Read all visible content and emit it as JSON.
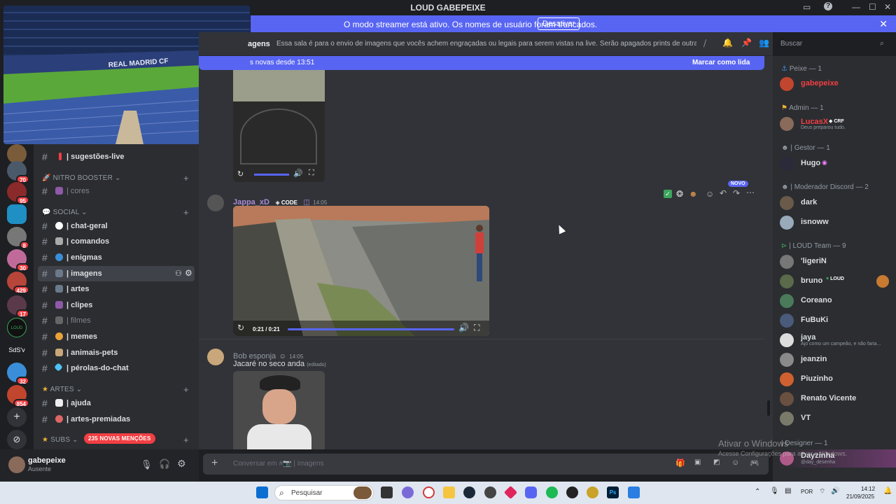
{
  "window": {
    "title": "LOUD GABEPEIXE",
    "icons": [
      "screen-share-icon",
      "help-icon",
      "minimize-icon",
      "maximize-icon",
      "close-icon"
    ]
  },
  "banner": {
    "message": "O modo streamer está ativo. Os nomes de usuário foram truncados.",
    "button": "Desativar"
  },
  "rail": {
    "items": [
      {
        "badge": "70"
      },
      {
        "badge": "95"
      },
      {
        "badge": "8"
      },
      {
        "badge": "30"
      },
      {
        "badge": "429"
      },
      {
        "badge": "17"
      },
      {
        "label": "LOUD"
      },
      {
        "label": "SdS'v"
      },
      {
        "badge": "32"
      },
      {
        "badge": "854"
      }
    ]
  },
  "video": {
    "stadium_text": "REAL MADRID CF"
  },
  "channels": {
    "items": [
      {
        "label": "| sugestões-live",
        "top": 0
      },
      {
        "category": "NITRO BOOSTER"
      },
      {
        "label": "| cores",
        "dim": true
      },
      {
        "category": "SOCIAL"
      },
      {
        "label": "| chat-geral"
      },
      {
        "label": "| comandos"
      },
      {
        "label": "| enigmas"
      },
      {
        "label": "| imagens",
        "active": true
      },
      {
        "label": "| artes"
      },
      {
        "label": "| clipes"
      },
      {
        "label": "| filmes",
        "dim": true
      },
      {
        "label": "| memes"
      },
      {
        "label": "| animais-pets"
      },
      {
        "label": "| pérolas-do-chat"
      },
      {
        "category": "ARTES"
      },
      {
        "label": "| ajuda"
      },
      {
        "label": "| artes-premiadas"
      },
      {
        "category": "SUBS",
        "mentions": "235 NOVAS MENÇÕES"
      }
    ]
  },
  "user": {
    "name": "gabepeixe",
    "status": "Ausente"
  },
  "header": {
    "channel": "agens",
    "topic": "Essa sala é para o envio de imagens que vocês achem engraçadas ou legais para serem vistas na live. Serão apagados prints de outras redes sociais c...",
    "search_placeholder": "Buscar"
  },
  "newbar": {
    "text": "s novas desde 13:51",
    "action": "Marcar como lida"
  },
  "messages": [
    {
      "author": "Jappa_xD",
      "tag": "CODE",
      "time": "14:05",
      "video_time": "0:21 / 0:21",
      "new_label": "NOVO"
    },
    {
      "author": "Bob esponja",
      "time": "14:05",
      "text": "Jacaré no seco anda",
      "edited": "(editado)"
    }
  ],
  "composer": {
    "placeholder": "Conversar em #📷 | imagens"
  },
  "members": {
    "groups": [
      {
        "title": "Peixe — 1",
        "members": [
          {
            "name": "gabepeixe",
            "color": "#f23f43"
          }
        ]
      },
      {
        "title": "Admin — 1",
        "members": [
          {
            "name": "LucasX",
            "color": "#f23f43",
            "tag": "CRF",
            "sub": "Deus preparou tudo."
          }
        ]
      },
      {
        "title": "| Gestor — 1",
        "members": [
          {
            "name": "Hugo",
            "color": "#ffffff"
          }
        ]
      },
      {
        "title": "| Moderador Discord — 2",
        "members": [
          {
            "name": "dark",
            "color": "#ffffff"
          },
          {
            "name": "isnoww",
            "color": "#ffffff"
          }
        ]
      },
      {
        "title": "| LOUD Team — 9",
        "members": [
          {
            "name": "'ligeriN",
            "color": "#ffffff"
          },
          {
            "name": "bruno",
            "color": "#ffffff",
            "tag": "LOUD"
          },
          {
            "name": "Coreano",
            "color": "#ffffff"
          },
          {
            "name": "FuBuKi",
            "color": "#ffffff"
          },
          {
            "name": "jaya",
            "color": "#ffffff",
            "sub": "Ajo como um campeão, e não faria..."
          },
          {
            "name": "jeanzin",
            "color": "#ffffff"
          },
          {
            "name": "Piuzinho",
            "color": "#ffffff"
          },
          {
            "name": "Renato Vicente",
            "color": "#ffffff"
          },
          {
            "name": "VT",
            "color": "#ffffff"
          }
        ]
      },
      {
        "title": "| Designer — 1",
        "members": [
          {
            "name": "Dayzinha",
            "color": "#ffffff",
            "sub": "@day_desenha"
          }
        ]
      }
    ]
  },
  "windows_watermark": {
    "line1": "Ativar o Windows",
    "line2": "Acesse Configurações para ativar o Windows."
  },
  "taskbar": {
    "search": "Pesquisar",
    "lang": "POR",
    "time": "14:12",
    "date": "21/09/2025"
  },
  "accent": "#5865f2"
}
